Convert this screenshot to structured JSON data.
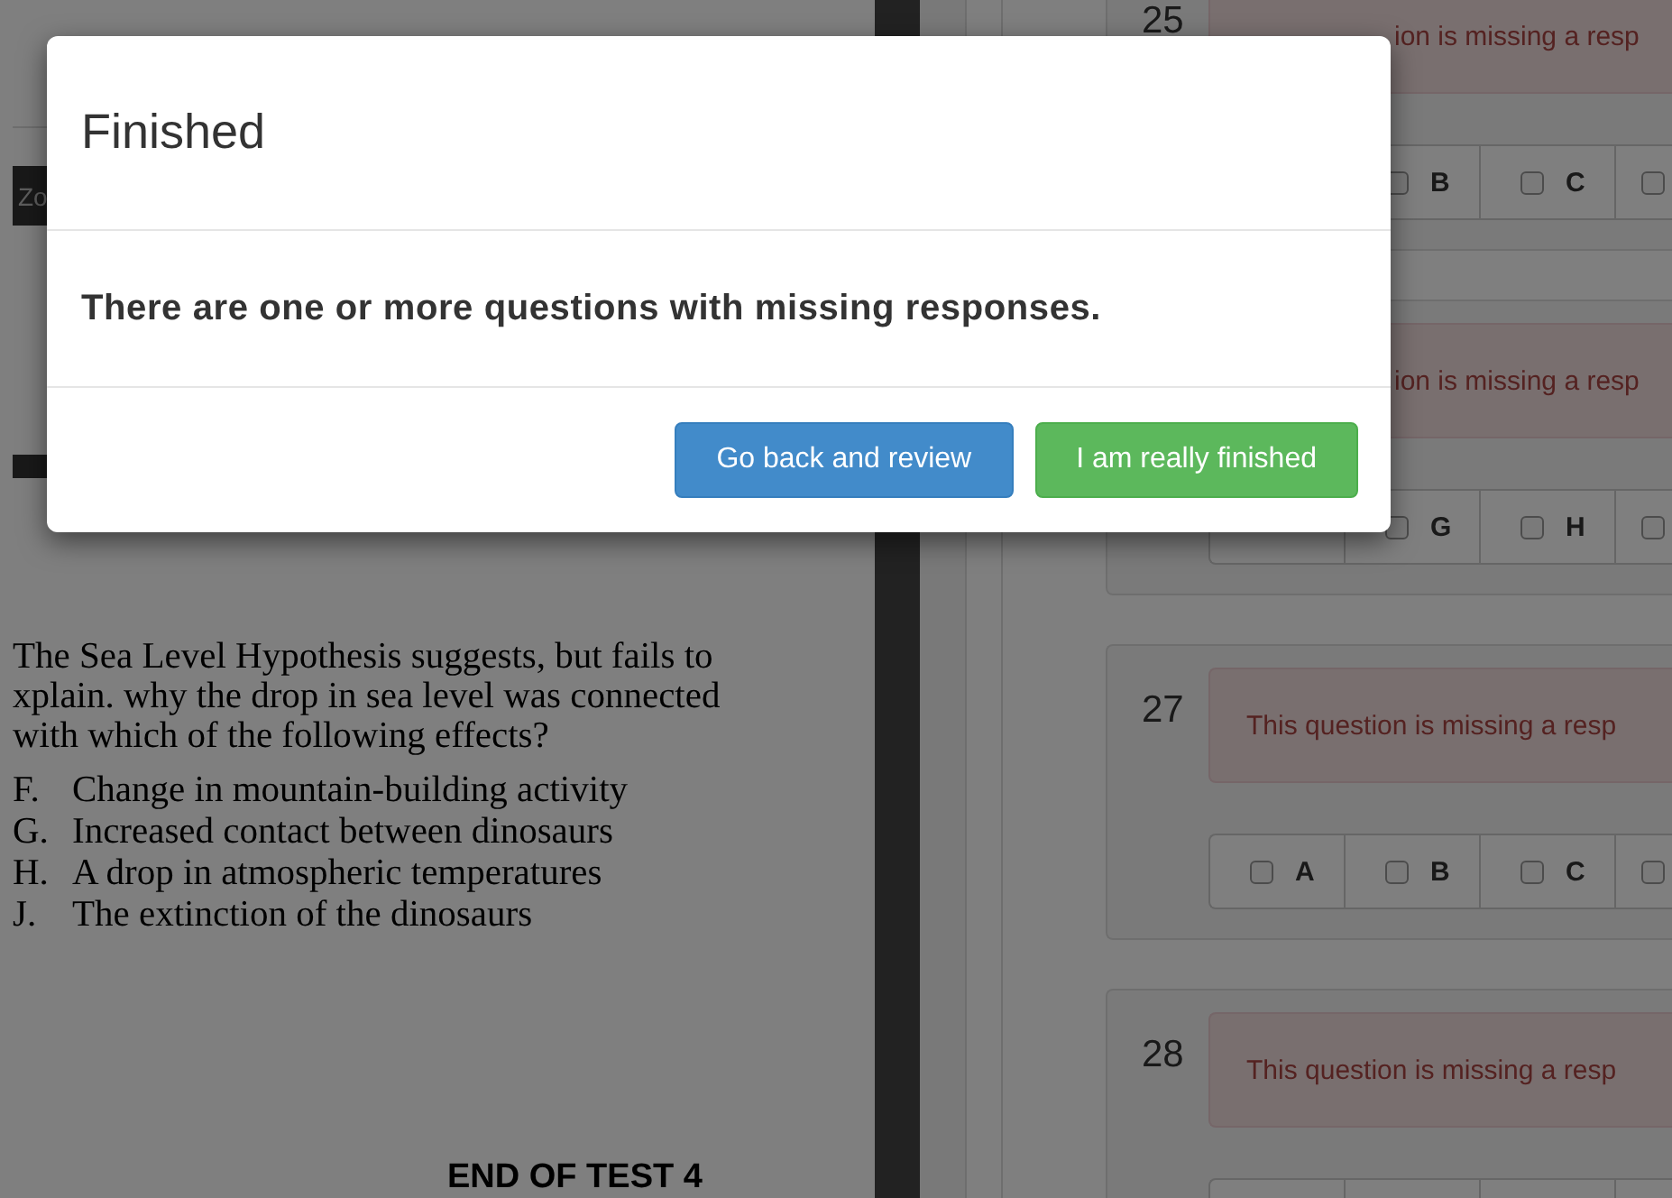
{
  "document": {
    "toolbar_label": "Zo",
    "question_lines": [
      "The Sea Level Hypothesis suggests, but fails to",
      "xplain. why the drop in sea level was connected",
      "with which of the following effects?"
    ],
    "options": [
      {
        "letter": "F.",
        "text": "Change in mountain-building activity"
      },
      {
        "letter": "G.",
        "text": "Increased contact between dinosaurs"
      },
      {
        "letter": "H.",
        "text": "A drop in atmospheric temperatures"
      },
      {
        "letter": "J.",
        "text": "The extinction of the dinosaurs"
      }
    ],
    "end_text": "END OF TEST 4"
  },
  "questions": [
    {
      "number": "25",
      "message": "ion is missing a resp",
      "message_clipped": true,
      "choices": [
        {
          "kind": "covered"
        },
        {
          "kind": "option",
          "label": "B",
          "checked": false
        },
        {
          "kind": "option",
          "label": "C",
          "checked": false
        },
        {
          "kind": "edge",
          "checked": false
        }
      ]
    },
    {
      "message": "ion is missing a resp",
      "message_clipped": true,
      "choices": [
        {
          "kind": "covered"
        },
        {
          "kind": "option",
          "label": "G",
          "checked": false
        },
        {
          "kind": "option",
          "label": "H",
          "checked": false
        },
        {
          "kind": "edge",
          "checked": false
        }
      ]
    },
    {
      "number": "27",
      "message": "This question is missing a resp",
      "choices": [
        {
          "kind": "option",
          "label": "A",
          "checked": false
        },
        {
          "kind": "option",
          "label": "B",
          "checked": false
        },
        {
          "kind": "option",
          "label": "C",
          "checked": false
        },
        {
          "kind": "edge",
          "checked": false
        }
      ]
    },
    {
      "number": "28",
      "message": "This question is missing a resp",
      "choices": [
        {
          "kind": "covered"
        },
        {
          "kind": "covered"
        },
        {
          "kind": "covered"
        },
        {
          "kind": "covered"
        }
      ]
    }
  ],
  "modal": {
    "title": "Finished",
    "message": "There are one or more questions with missing responses.",
    "buttons": [
      {
        "label": "Go back and review",
        "kind": "primary"
      },
      {
        "label": "I am really finished",
        "kind": "success"
      }
    ]
  }
}
